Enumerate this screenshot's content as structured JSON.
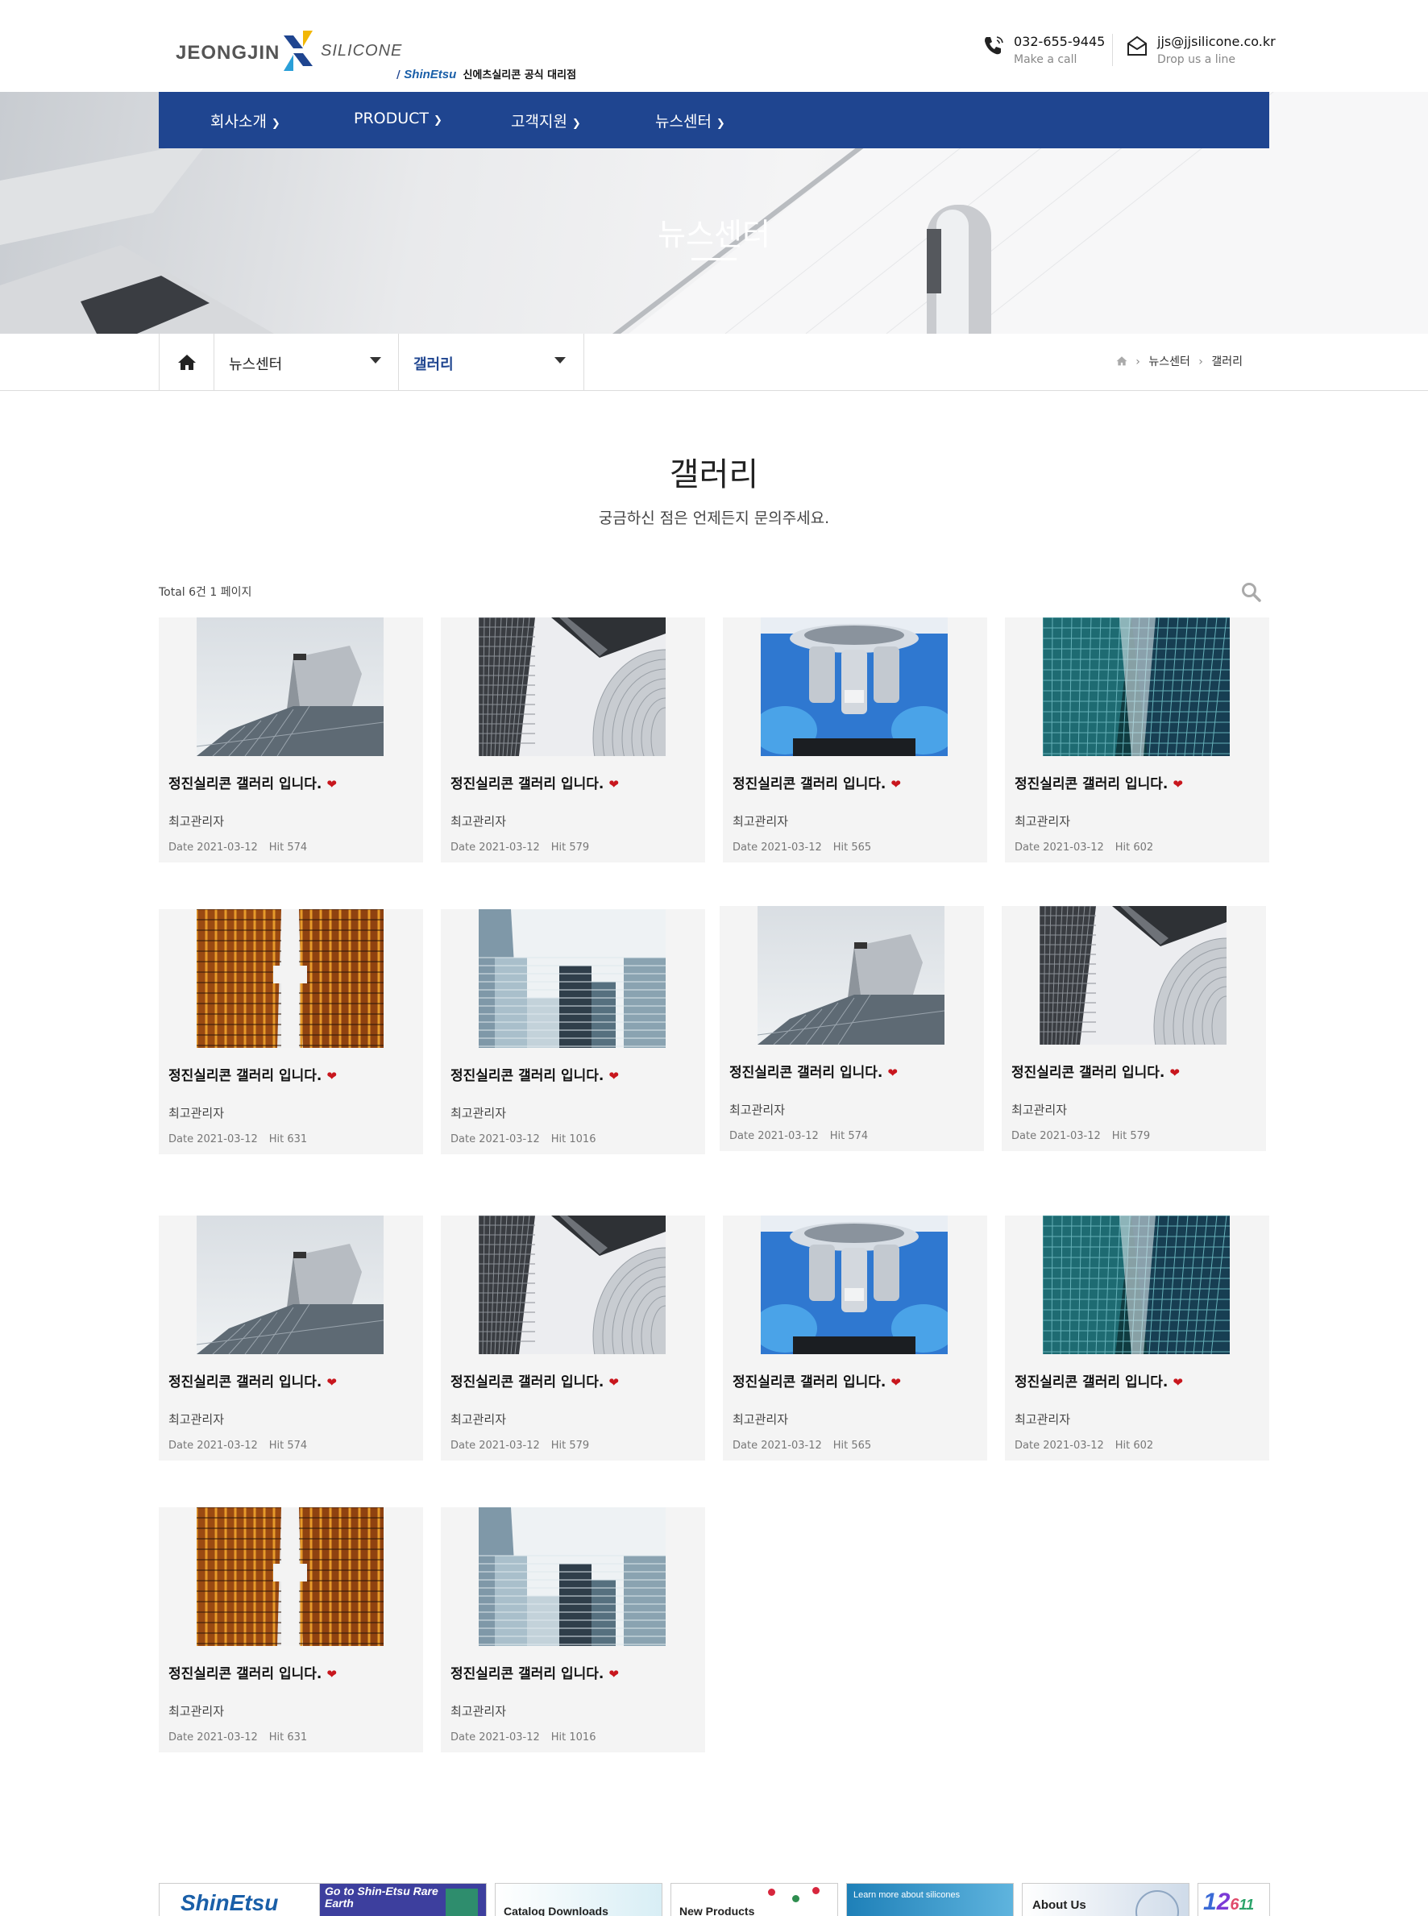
{
  "header": {
    "logo": {
      "brand_left": "JEONGJIN",
      "brand_right": "SILICONE",
      "partner": "ShinEtsu",
      "partner_sub": "신에츠실리콘 공식 대리점"
    },
    "phone": {
      "number": "032-655-9445",
      "caption": "Make a call"
    },
    "email": {
      "address": "jjs@jjsilicone.co.kr",
      "caption": "Drop us a line"
    }
  },
  "nav": {
    "items": [
      {
        "label": "회사소개"
      },
      {
        "label": "PRODUCT"
      },
      {
        "label": "고객지원"
      },
      {
        "label": "뉴스센터"
      }
    ]
  },
  "hero": {
    "title": "뉴스센터"
  },
  "subnav": {
    "section": "뉴스센터",
    "page": "갤러리",
    "breadcrumb": [
      "뉴스센터",
      "갤러리"
    ]
  },
  "main": {
    "title": "갤러리",
    "description": "궁금하신 점은 언제든지 문의주세요.",
    "total": "Total 6건 1 페이지"
  },
  "gallery": {
    "items": [
      {
        "title": "정진실리콘 갤러리 입니다.",
        "author": "최고관리자",
        "date": "Date 2021-03-12",
        "hit": "Hit 574",
        "image": "glass-building"
      },
      {
        "title": "정진실리콘 갤러리 입니다.",
        "author": "최고관리자",
        "date": "Date 2021-03-12",
        "hit": "Hit 579",
        "image": "skyscraper-lookup"
      },
      {
        "title": "정진실리콘 갤러리 입니다.",
        "author": "최고관리자",
        "date": "Date 2021-03-12",
        "hit": "Hit 565",
        "image": "microscope"
      },
      {
        "title": "정진실리콘 갤러리 입니다.",
        "author": "최고관리자",
        "date": "Date 2021-03-12",
        "hit": "Hit 602",
        "image": "blue-tower"
      },
      {
        "title": "정진실리콘 갤러리 입니다.",
        "author": "최고관리자",
        "date": "Date 2021-03-12",
        "hit": "Hit 631",
        "image": "orange-towers"
      },
      {
        "title": "정진실리콘 갤러리 입니다.",
        "author": "최고관리자",
        "date": "Date 2021-03-12",
        "hit": "Hit 1016",
        "image": "city-towers"
      },
      {
        "title": "정진실리콘 갤러리 입니다.",
        "author": "최고관리자",
        "date": "Date 2021-03-12",
        "hit": "Hit 574",
        "image": "glass-building"
      },
      {
        "title": "정진실리콘 갤러리 입니다.",
        "author": "최고관리자",
        "date": "Date 2021-03-12",
        "hit": "Hit 579",
        "image": "skyscraper-lookup"
      },
      {
        "title": "정진실리콘 갤러리 입니다.",
        "author": "최고관리자",
        "date": "Date 2021-03-12",
        "hit": "Hit 574",
        "image": "glass-building"
      },
      {
        "title": "정진실리콘 갤러리 입니다.",
        "author": "최고관리자",
        "date": "Date 2021-03-12",
        "hit": "Hit 579",
        "image": "skyscraper-lookup"
      },
      {
        "title": "정진실리콘 갤러리 입니다.",
        "author": "최고관리자",
        "date": "Date 2021-03-12",
        "hit": "Hit 565",
        "image": "microscope"
      },
      {
        "title": "정진실리콘 갤러리 입니다.",
        "author": "최고관리자",
        "date": "Date 2021-03-12",
        "hit": "Hit 602",
        "image": "blue-tower"
      },
      {
        "title": "정진실리콘 갤러리 입니다.",
        "author": "최고관리자",
        "date": "Date 2021-03-12",
        "hit": "Hit 631",
        "image": "orange-towers"
      },
      {
        "title": "정진실리콘 갤러리 입니다.",
        "author": "최고관리자",
        "date": "Date 2021-03-12",
        "hit": "Hit 1016",
        "image": "city-towers"
      }
    ]
  },
  "footer_banners": [
    {
      "label": "ShinEtsu"
    },
    {
      "label": "Go to Shin-Etsu Rare Earth"
    },
    {
      "label": "Catalog Downloads"
    },
    {
      "label": "New Products"
    },
    {
      "label": "Learn more about silicones"
    },
    {
      "label": "About Us"
    },
    {
      "label": ""
    }
  ],
  "colors": {
    "nav": "#1f4590",
    "accent": "#1f4590",
    "heart": "#c8161d",
    "card_bg": "#f4f4f4"
  }
}
